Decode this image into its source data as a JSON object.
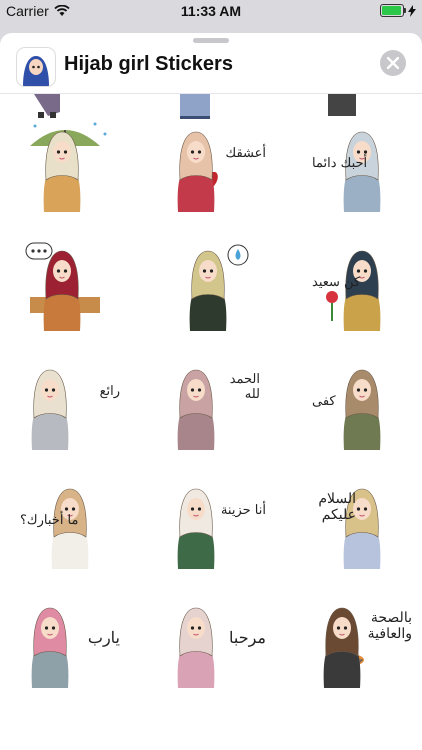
{
  "status_bar": {
    "carrier": "Carrier",
    "time": "11:33 AM"
  },
  "header": {
    "title": "Hijab girl Stickers",
    "icon": "app-icon-hijab-girl",
    "close": "close-icon"
  },
  "stickers": [
    {
      "caption": "",
      "name": "sticker-umbrella-rain"
    },
    {
      "caption": "أعشقك",
      "name": "sticker-heart-love"
    },
    {
      "caption": "أحبك دائما",
      "name": "sticker-love-you-always"
    },
    {
      "caption": "",
      "name": "sticker-speech-bubble"
    },
    {
      "caption": "",
      "name": "sticker-tear-drop"
    },
    {
      "caption": "كن سعيد",
      "name": "sticker-be-happy"
    },
    {
      "caption": "رائع",
      "name": "sticker-awesome"
    },
    {
      "caption": "الحمد لله",
      "name": "sticker-alhamdulillah"
    },
    {
      "caption": "كفى",
      "name": "sticker-enough"
    },
    {
      "caption": "ما أخبارك؟",
      "name": "sticker-how-are-you"
    },
    {
      "caption": "أنا حزينة",
      "name": "sticker-i-am-sad"
    },
    {
      "caption": "السلام عليكم",
      "name": "sticker-salam"
    },
    {
      "caption": "يارب",
      "name": "sticker-ya-rab"
    },
    {
      "caption": "مرحبا",
      "name": "sticker-hello"
    },
    {
      "caption": "بالصحة والعافية",
      "name": "sticker-bon-appetit"
    }
  ]
}
